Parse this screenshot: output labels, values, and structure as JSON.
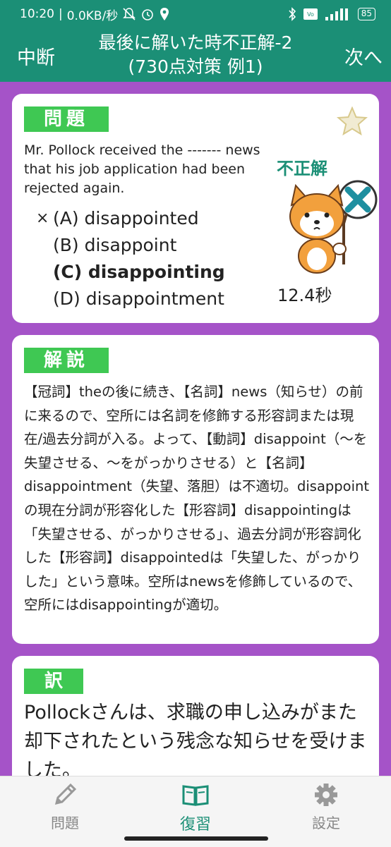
{
  "status_bar": {
    "time": "10:20",
    "network_speed": "0.0KB/秒",
    "battery": "85"
  },
  "app_bar": {
    "left_button": "中断",
    "title_line1": "最後に解いた時不正解-2",
    "title_line2": "(730点対策 例1)",
    "right_button": "次へ"
  },
  "question_card": {
    "tag": "問題",
    "text": "Mr. Pollock received the ------- news that his job application had been rejected again.",
    "options": [
      {
        "mark": "×",
        "label": "(A) disappointed",
        "correct": false
      },
      {
        "mark": "",
        "label": "(B) disappoint",
        "correct": false
      },
      {
        "mark": "",
        "label": "(C) disappointing",
        "correct": true
      },
      {
        "mark": "",
        "label": "(D) disappointment",
        "correct": false
      }
    ],
    "result": "不正解",
    "time": "12.4秒"
  },
  "explanation_card": {
    "tag": "解説",
    "text": "【冠詞】theの後に続き、【名詞】news（知らせ）の前に来るので、空所には名詞を修飾する形容詞または現在/過去分詞が入る。よって、【動詞】disappoint（～を失望させる、～をがっかりさせる）と【名詞】disappointment（失望、落胆）は不適切。disappointの現在分詞が形容化した【形容詞】disappointingは「失望させる、がっかりさせる」、過去分詞が形容詞化した【形容詞】disappointedは「失望した、がっかりした」という意味。空所はnewsを修飾しているので、空所にはdisappointingが適切。"
  },
  "translation_card": {
    "tag": "訳",
    "text": "Pollockさんは、求職の申し込みがまた却下されたという残念な知らせを受けました。"
  },
  "bottom_nav": {
    "items": [
      {
        "label": "問題",
        "icon": "pencil-icon",
        "active": false
      },
      {
        "label": "復習",
        "icon": "book-icon",
        "active": true
      },
      {
        "label": "設定",
        "icon": "gear-icon",
        "active": false
      }
    ]
  },
  "colors": {
    "primary": "#1b8f76",
    "background": "#a553c8",
    "tag": "#3fc853",
    "wrong_mark": "#1e8fa0"
  }
}
